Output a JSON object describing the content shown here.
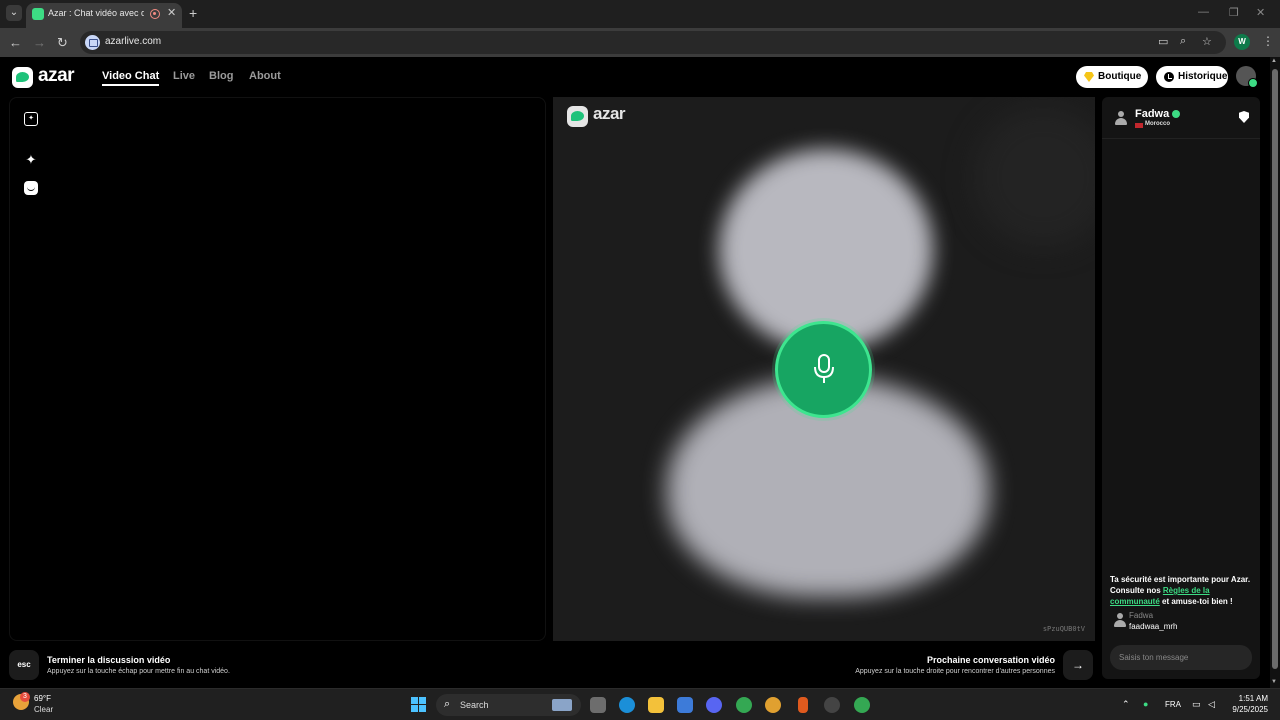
{
  "browser": {
    "tab_title": "Azar : Chat vidéo avec de n",
    "url": "azarlive.com",
    "profile_initial": "W"
  },
  "header": {
    "logo_text": "azar",
    "nav": [
      {
        "label": "Video Chat",
        "active": true
      },
      {
        "label": "Live",
        "active": false
      },
      {
        "label": "Blog",
        "active": false
      },
      {
        "label": "About",
        "active": false
      }
    ],
    "boutique_label": "Boutique",
    "historique_label": "Historique"
  },
  "peer": {
    "logo_text": "azar",
    "id": "sPzuQUB0tV"
  },
  "chat": {
    "name": "Fadwa",
    "country": "Morocco",
    "safety_text_1": "Ta sécurité est importante pour Azar. Consulte nos ",
    "safety_link": "Règles de la communauté",
    "safety_text_2": " et amuse-toi bien !",
    "message_sender": "Fadwa",
    "message_text": "faadwaa_mrh",
    "input_placeholder": "Saisis ton message"
  },
  "footer": {
    "esc_label": "esc",
    "end_title": "Terminer la discussion vidéo",
    "end_sub": "Appuyez sur la touche échap pour mettre fin au chat vidéo.",
    "next_title": "Prochaine conversation vidéo",
    "next_sub": "Appuyez sur la touche droite pour rencontrer d'autres personnes"
  },
  "taskbar": {
    "weather_badge": "3",
    "temp": "69°F",
    "condition": "Clear",
    "search_label": "Search",
    "lang": "FRA",
    "time": "1:51 AM",
    "date": "9/25/2025"
  },
  "colors": {
    "accent_green": "#3ddc84",
    "mic_green": "#17a562"
  }
}
